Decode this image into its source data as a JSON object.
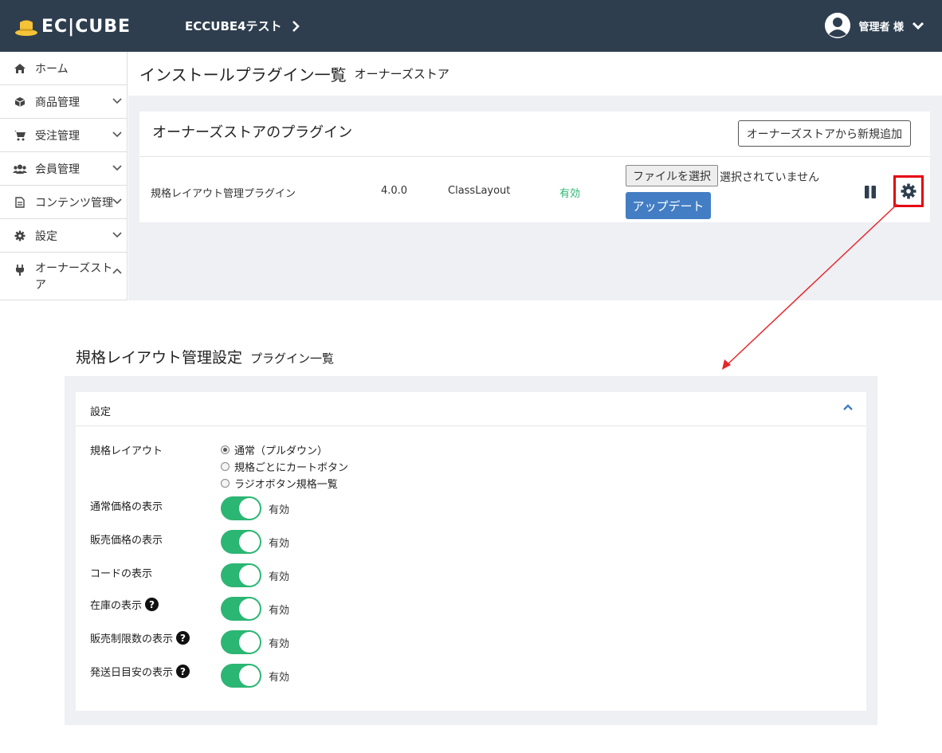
{
  "header": {
    "logo_text": "EC|CUBE",
    "shop_name": "ECCUBE4テスト",
    "user_label": "管理者 様"
  },
  "sidebar": {
    "items": [
      {
        "label": "ホーム",
        "icon": "home-icon"
      },
      {
        "label": "商品管理",
        "icon": "cube-icon"
      },
      {
        "label": "受注管理",
        "icon": "cart-icon"
      },
      {
        "label": "会員管理",
        "icon": "users-icon"
      },
      {
        "label": "コンテンツ管理",
        "icon": "file-icon"
      },
      {
        "label": "設定",
        "icon": "gear-icon"
      },
      {
        "label": "オーナーズストア",
        "icon": "plug-icon"
      }
    ]
  },
  "page": {
    "title": "インストールプラグイン一覧",
    "subtitle": "オーナーズストア"
  },
  "card": {
    "title": "オーナーズストアのプラグイン",
    "add_button": "オーナーズストアから新規追加"
  },
  "plugin_row": {
    "name": "規格レイアウト管理プラグイン",
    "version": "4.0.0",
    "code": "ClassLayout",
    "status": "有効",
    "file_button": "ファイルを選択",
    "file_status": "選択されていません",
    "update_button": "アップデート"
  },
  "settings": {
    "title": "規格レイアウト管理設定",
    "subtitle": "プラグイン一覧",
    "panel_label": "設定",
    "layout_label": "規格レイアウト",
    "layout_options": [
      "通常（プルダウン）",
      "規格ごとにカートボタン",
      "ラジオボタン規格一覧"
    ],
    "layout_selected": 0,
    "toggles": [
      {
        "label": "通常価格の表示",
        "state": "有効",
        "help": false
      },
      {
        "label": "販売価格の表示",
        "state": "有効",
        "help": false
      },
      {
        "label": "コードの表示",
        "state": "有効",
        "help": false
      },
      {
        "label": "在庫の表示",
        "state": "有効",
        "help": true
      },
      {
        "label": "販売制限数の表示",
        "state": "有効",
        "help": true
      },
      {
        "label": "発送日目安の表示",
        "state": "有効",
        "help": true
      }
    ]
  },
  "colors": {
    "header_bg": "#2e3e4f",
    "primary": "#437ec4",
    "enabled_green": "#2bb673",
    "highlight_red": "#e60012"
  }
}
